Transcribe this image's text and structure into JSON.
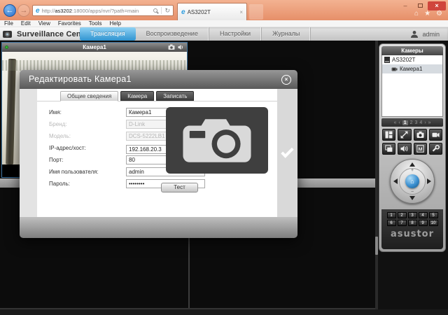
{
  "browser": {
    "url": {
      "scheme": "http://",
      "host": "as3202",
      "port": ":18000",
      "path": "/apps/nvr/?path=main"
    },
    "tab": {
      "title": "AS3202T",
      "close": "×"
    },
    "address_icons": {
      "refresh": "↻"
    },
    "window_controls": {
      "minimize": "–",
      "close": "×"
    },
    "quick_icons": {
      "home": "⌂",
      "favorites": "★",
      "settings": "⚙"
    },
    "menu": [
      "File",
      "Edit",
      "View",
      "Favorites",
      "Tools",
      "Help"
    ]
  },
  "nav": {
    "app_title": "Surveillance Center",
    "tabs": [
      {
        "label": "Трансляция",
        "active": true
      },
      {
        "label": "Воспроизведение",
        "active": false
      },
      {
        "label": "Настройки",
        "active": false
      },
      {
        "label": "Журналы",
        "active": false
      }
    ],
    "user": "admin"
  },
  "viewport": {
    "tile_title": "Камера1"
  },
  "sidebar": {
    "panel_title": "Камеры",
    "tree": [
      {
        "label": "AS3202T",
        "level": 0
      },
      {
        "label": "Камера1",
        "level": 1,
        "selected": true
      }
    ],
    "pagination": {
      "first": "«",
      "prev": "‹",
      "pages": [
        "1",
        "2",
        "3",
        "4"
      ],
      "current": "1",
      "next": "›",
      "last": "»"
    },
    "toolbar_icons": [
      "layout",
      "fullscreen",
      "snapshot",
      "record",
      "sequence",
      "audio",
      "map",
      "settings"
    ],
    "ptz": {
      "zoom_in": "+",
      "zoom_out": "−",
      "home": "⌂"
    },
    "presets": [
      "1",
      "2",
      "3",
      "4",
      "5",
      "6",
      "7",
      "8",
      "9",
      "10"
    ],
    "logo": "asustor"
  },
  "modal": {
    "title": "Редактировать Камера1",
    "close_icon": "×",
    "tabs": [
      {
        "label": "Общие сведения",
        "active": true
      },
      {
        "label": "Камера",
        "active": false
      },
      {
        "label": "Записать",
        "active": false
      }
    ],
    "fields": [
      {
        "label": "Имя:",
        "value": "Камера1"
      },
      {
        "label": "Бренд:",
        "value": "D-Link",
        "disabled": true
      },
      {
        "label": "Модель:",
        "value": "DCS-5222LB1",
        "disabled": true
      },
      {
        "label": "IP-адрес/хост:",
        "value": "192.168.20.3",
        "clearable": true,
        "clear_icon": "×"
      },
      {
        "label": "Порт:",
        "value": "80"
      },
      {
        "label": "Имя пользователя:",
        "value": "admin"
      },
      {
        "label": "Пароль:",
        "value": "••••••••"
      }
    ],
    "select_arrow": "▾",
    "test_button": "Тест"
  },
  "icons": {
    "back_arrow": "←",
    "forward_arrow": "→"
  },
  "colors": {
    "chrome_orange": "#e89a76",
    "active_tab_blue": "#2f93d0",
    "close_red": "#d0453c",
    "status_green": "#35b335",
    "modal_header_gray": "#6f6f6f"
  }
}
